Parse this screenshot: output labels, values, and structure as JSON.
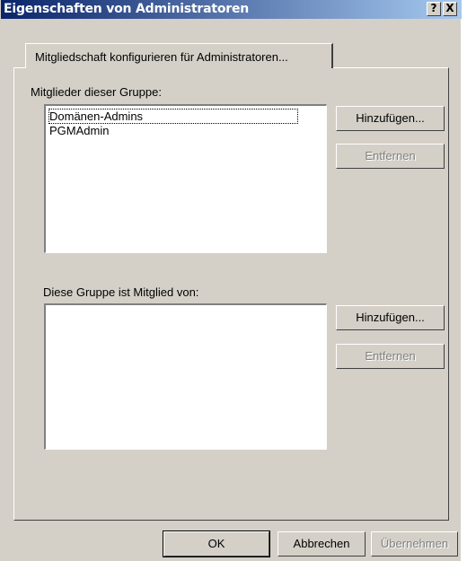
{
  "window": {
    "title": "Eigenschaften von Administratoren",
    "help_button": "?",
    "close_button": "X"
  },
  "tabs": [
    {
      "label": "Mitgliedschaft konfigurieren für Administratoren..."
    }
  ],
  "members_section": {
    "label": "Mitglieder dieser Gruppe:",
    "items": [
      "Domänen-Admins",
      "PGMAdmin"
    ],
    "add_button": "Hinzufügen...",
    "remove_button": "Entfernen"
  },
  "memberof_section": {
    "label": "Diese Gruppe ist Mitglied von:",
    "items": [],
    "add_button": "Hinzufügen...",
    "remove_button": "Entfernen"
  },
  "footer": {
    "ok_button": "OK",
    "cancel_button": "Abbrechen",
    "apply_button": "Übernehmen"
  }
}
